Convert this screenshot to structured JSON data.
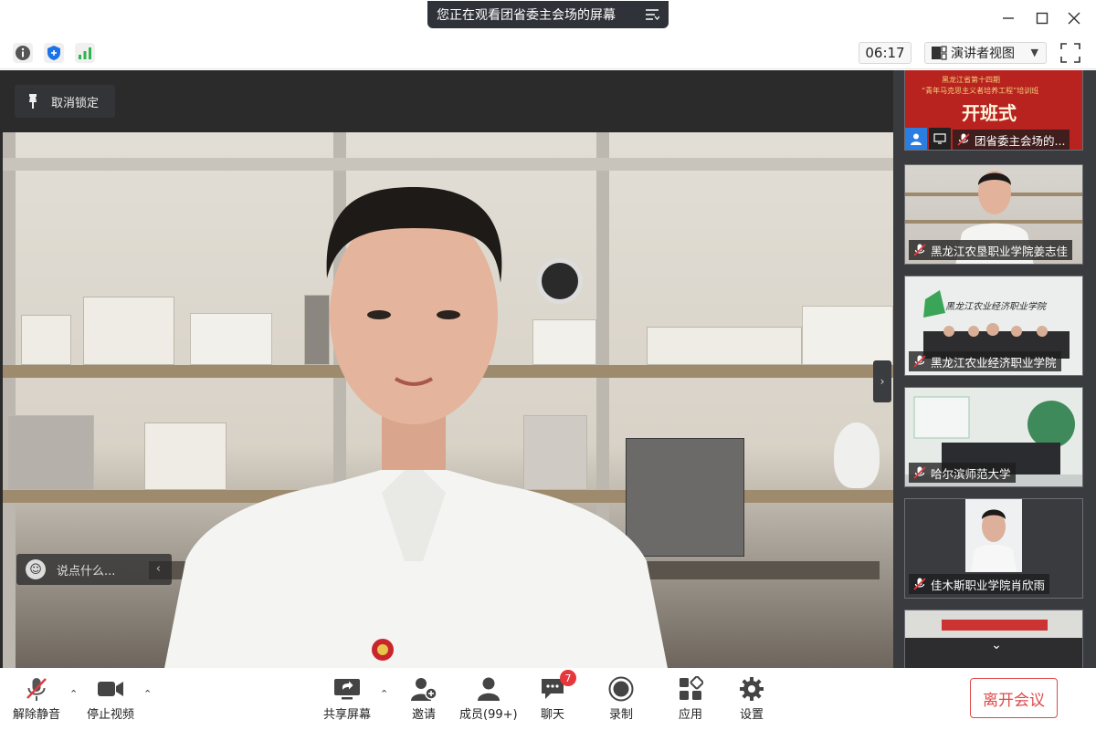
{
  "title_bar": {
    "share_notice": "您正在观看团省委主会场的屏幕",
    "minimize_icon": "minimize-icon",
    "maximize_icon": "maximize-icon",
    "close_icon": "close-icon"
  },
  "info_bar": {
    "timer": "06:17",
    "view_mode": "演讲者视图"
  },
  "main_video": {
    "unpin_label": "取消锁定",
    "chat_placeholder": "说点什么..."
  },
  "participants": [
    {
      "name": "团省委主会场的...",
      "muted": true,
      "sharing": true,
      "host": true,
      "banner_top": "黑龙江省第十四期",
      "banner_sub": "“青年马克思主义者培养工程”培训班",
      "banner_main": "开班式"
    },
    {
      "name": "黑龙江农垦职业学院姜志佳",
      "muted": true
    },
    {
      "name": "黑龙江农业经济职业学院",
      "muted": true,
      "sign_text": "黑龙江农业经济职业学院"
    },
    {
      "name": "哈尔滨师范大学",
      "muted": true
    },
    {
      "name": "佳木斯职业学院肖欣雨",
      "muted": true
    }
  ],
  "toolbar": {
    "unmute": "解除静音",
    "stop_video": "停止视频",
    "share_screen": "共享屏幕",
    "invite": "邀请",
    "members": "成员(99+)",
    "chat": "聊天",
    "chat_badge": "7",
    "record": "录制",
    "apps": "应用",
    "settings": "设置",
    "leave": "离开会议"
  },
  "colors": {
    "accent_red": "#e04848",
    "panel_bg": "#3a3b3f",
    "badge_red": "#e5373c",
    "signal_green": "#2fb44f",
    "shield_blue": "#1a73e8"
  }
}
